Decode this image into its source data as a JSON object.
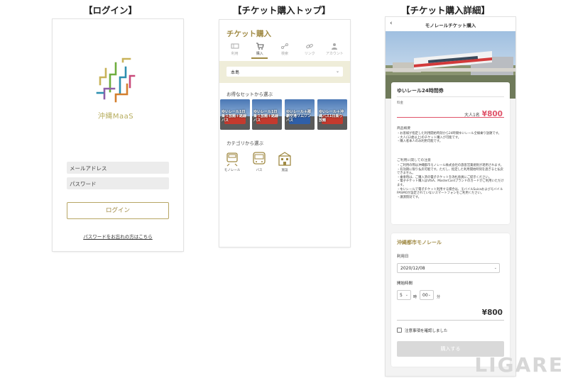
{
  "sections": {
    "login_title": "【ログイン】",
    "top_title": "【チケット購入トップ】",
    "detail_title": "【チケット購入詳細】"
  },
  "login": {
    "logo_text": "沖縄MaaS",
    "email_placeholder": "メールアドレス",
    "password_placeholder": "パスワード",
    "login_button": "ログイン",
    "forgot_link": "パスワードをお忘れの方はこちら"
  },
  "ticket_top": {
    "title": "チケット購入",
    "tabs": [
      {
        "label": "利用",
        "icon": "ticket-icon"
      },
      {
        "label": "購入",
        "icon": "cart-icon"
      },
      {
        "label": "検索",
        "icon": "route-icon"
      },
      {
        "label": "リンク",
        "icon": "link-icon"
      },
      {
        "label": "アカウント",
        "icon": "account-icon"
      }
    ],
    "active_tab": "購入",
    "region_select": "本島",
    "sets_label": "お得なセットから選ぶ",
    "set_cards": [
      {
        "caption": "ゆいレール1日乗り放題＋路線バス"
      },
      {
        "caption": "ゆいレール1日乗り放題＋路線バス"
      },
      {
        "caption": "ゆいレール＋那覇空港リムジンバス"
      },
      {
        "caption": "ゆいレール＋沖縄バス1日乗り放題"
      }
    ],
    "category_label": "カテゴリから選ぶ",
    "categories": [
      {
        "label": "モノレール",
        "icon": "monorail-icon"
      },
      {
        "label": "バス",
        "icon": "bus-icon"
      },
      {
        "label": "施設",
        "icon": "building-icon"
      }
    ]
  },
  "ticket_detail": {
    "header_title": "モノレールチケット購入",
    "ticket_name": "ゆいレール24時間券",
    "price_label": "料金",
    "price_who": "大人1名",
    "price": "¥800",
    "overview_label": "商品概要",
    "overview_lines": [
      "・お客様が指定した利用開始時刻から24時間ゆいレール全線乗り放題です。",
      "・大人(12歳以上)のチケット購入が可能です。",
      "・購入者本人のみ利用可能です。"
    ],
    "notes_label": "ご利用に関しての注意",
    "notes_lines": [
      "・ご利用の際は沖縄都市モノレール株式会社の旅客営業規則が適用されます。",
      "・有効期に限り払戻可能です。ただし、指定した利用開始時刻を過ぎると払戻できません。",
      "・乗車時は、ご購入済の電子チケットを改札係員にご提示ください。",
      "・電子チケット購入はVISA、MasterCardブランドのカードがご利用いただけます。",
      "・ゆいレールで電子チケット利用する場合は、モバイルSuicaおよびモバイルPASMOが設定されていないスマートフォンをご利用ください。",
      "・譲渡無効です。"
    ],
    "operator": "沖縄都市モノレール",
    "date_label": "利用日",
    "date_value": "2020/12/08",
    "time_label": "開始時間",
    "hour_value": "5",
    "hour_unit": "時",
    "minute_value": "00",
    "minute_unit": "分",
    "total": "¥800",
    "confirm_label": "注意事項を確認しました",
    "purchase_button": "購入する"
  },
  "watermark": "LIGARE",
  "colors": {
    "gold": "#a08a44",
    "price_pink": "#e0546a",
    "band": "#efedd9",
    "disabled_button": "#d9d9d9"
  }
}
